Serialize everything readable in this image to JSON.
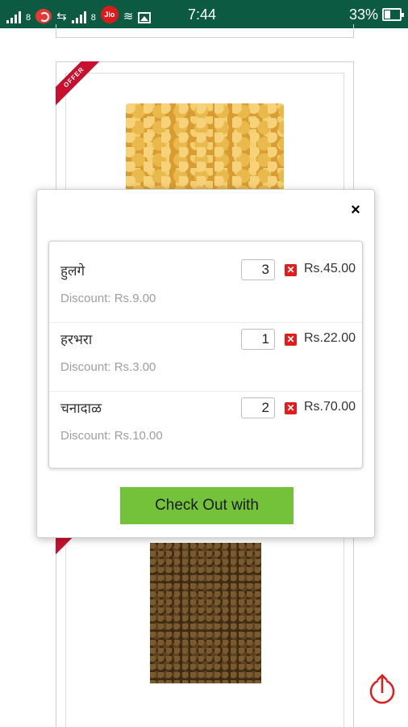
{
  "status_bar": {
    "carrier_1_tag": "8",
    "carrier_2_tag": "8",
    "carrier_logo": "Jio",
    "time": "7:44",
    "battery": "33%"
  },
  "background": {
    "offer_ribbon": "OFFER"
  },
  "cart_modal": {
    "close_label": "×",
    "items": [
      {
        "name": "हुलगे",
        "quantity": "3",
        "price": "Rs.45.00",
        "discount": "Discount: Rs.9.00"
      },
      {
        "name": "हरभरा",
        "quantity": "1",
        "price": "Rs.22.00",
        "discount": "Discount: Rs.3.00"
      },
      {
        "name": "चनादाळ",
        "quantity": "2",
        "price": "Rs.70.00",
        "discount": "Discount: Rs.10.00"
      }
    ],
    "checkout_label": "Check Out with"
  },
  "colors": {
    "status_bar": "#0b5a41",
    "checkout_button": "#73c23a",
    "remove_icon": "#e21c1c",
    "offer_ribbon": "#c8102e"
  },
  "icons": {
    "share": "share-icon",
    "remove": "remove-icon",
    "close": "close-icon"
  }
}
